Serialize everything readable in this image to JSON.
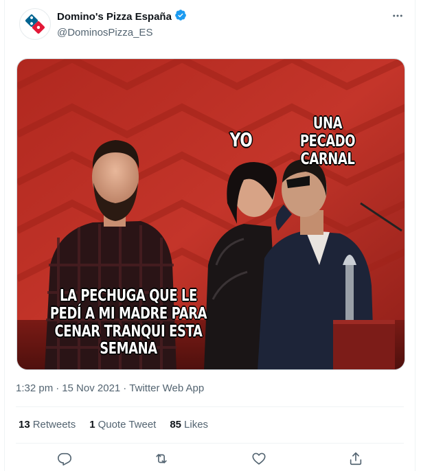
{
  "tweet": {
    "author": {
      "display_name": "Domino's Pizza España",
      "handle": "@DominosPizza_ES",
      "verified": true,
      "verified_color": "#1d9bf0"
    },
    "media": {
      "captions": {
        "yo": "YO",
        "una": "UNA\nPECADO CARNAL",
        "pechuga": "LA PECHUGA QUE LE\nPEDÍ A MI MADRE PARA\nCENAR TRANQUI ESTA SEMANA"
      }
    },
    "meta": {
      "time": "1:32 pm",
      "separator": "·",
      "date": "15 Nov 2021",
      "source": "Twitter Web App"
    },
    "stats": {
      "retweets_count": "13",
      "retweets_label": "Retweets",
      "quotes_count": "1",
      "quotes_label": "Quote Tweet",
      "likes_count": "85",
      "likes_label": "Likes"
    },
    "actions": [
      "reply-icon",
      "retweet-icon",
      "like-icon",
      "share-icon"
    ]
  },
  "colors": {
    "brand_blue": "#006491",
    "brand_red": "#e31837",
    "text_secondary": "#536471",
    "icon_gray": "#536471"
  }
}
